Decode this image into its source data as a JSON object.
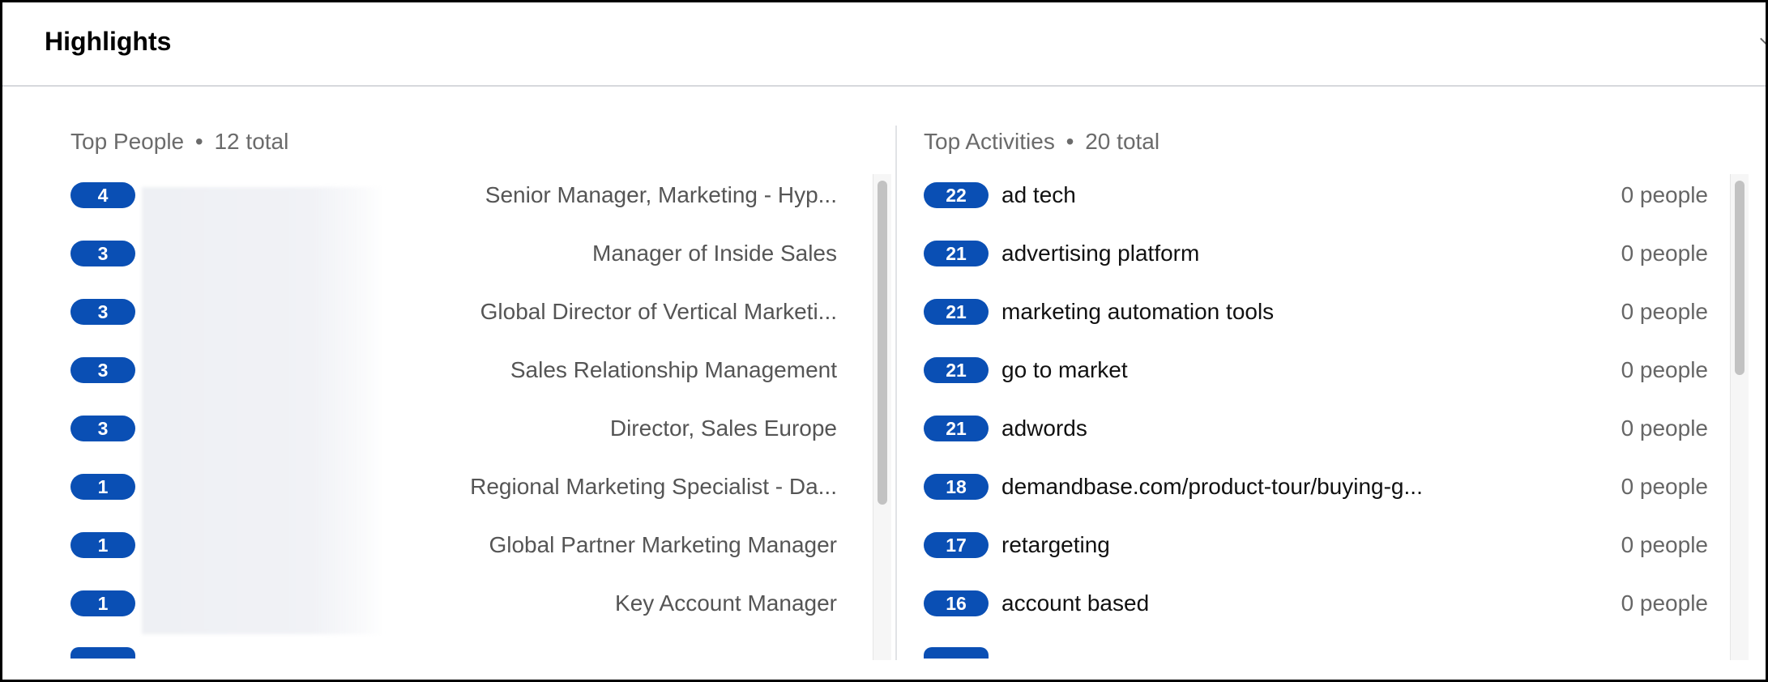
{
  "card": {
    "title": "Highlights"
  },
  "people": {
    "heading": "Top People",
    "separator": "•",
    "total": "12 total",
    "rows": [
      {
        "count": "4",
        "title": "Senior Manager, Marketing - Hyp..."
      },
      {
        "count": "3",
        "title": "Manager of Inside Sales"
      },
      {
        "count": "3",
        "title": "Global Director of Vertical Marketi..."
      },
      {
        "count": "3",
        "title": "Sales Relationship Management"
      },
      {
        "count": "3",
        "title": "Director, Sales Europe"
      },
      {
        "count": "1",
        "title": "Regional Marketing Specialist - Da..."
      },
      {
        "count": "1",
        "title": "Global Partner Marketing Manager"
      },
      {
        "count": "1",
        "title": "Key Account Manager"
      }
    ]
  },
  "activities": {
    "heading": "Top Activities",
    "separator": "•",
    "total": "20 total",
    "rows": [
      {
        "count": "22",
        "name": "ad tech",
        "people": "0 people"
      },
      {
        "count": "21",
        "name": "advertising platform",
        "people": "0 people"
      },
      {
        "count": "21",
        "name": "marketing automation tools",
        "people": "0 people"
      },
      {
        "count": "21",
        "name": "go to market",
        "people": "0 people"
      },
      {
        "count": "21",
        "name": "adwords",
        "people": "0 people"
      },
      {
        "count": "18",
        "name": "demandbase.com/product-tour/buying-g...",
        "people": "0 people"
      },
      {
        "count": "17",
        "name": "retargeting",
        "people": "0 people"
      },
      {
        "count": "16",
        "name": "account based",
        "people": "0 people"
      }
    ]
  },
  "colors": {
    "badge": "#0a4fb4",
    "accent": "#0a4fb4"
  },
  "icons": {
    "collapse": "chevron-up-icon"
  }
}
